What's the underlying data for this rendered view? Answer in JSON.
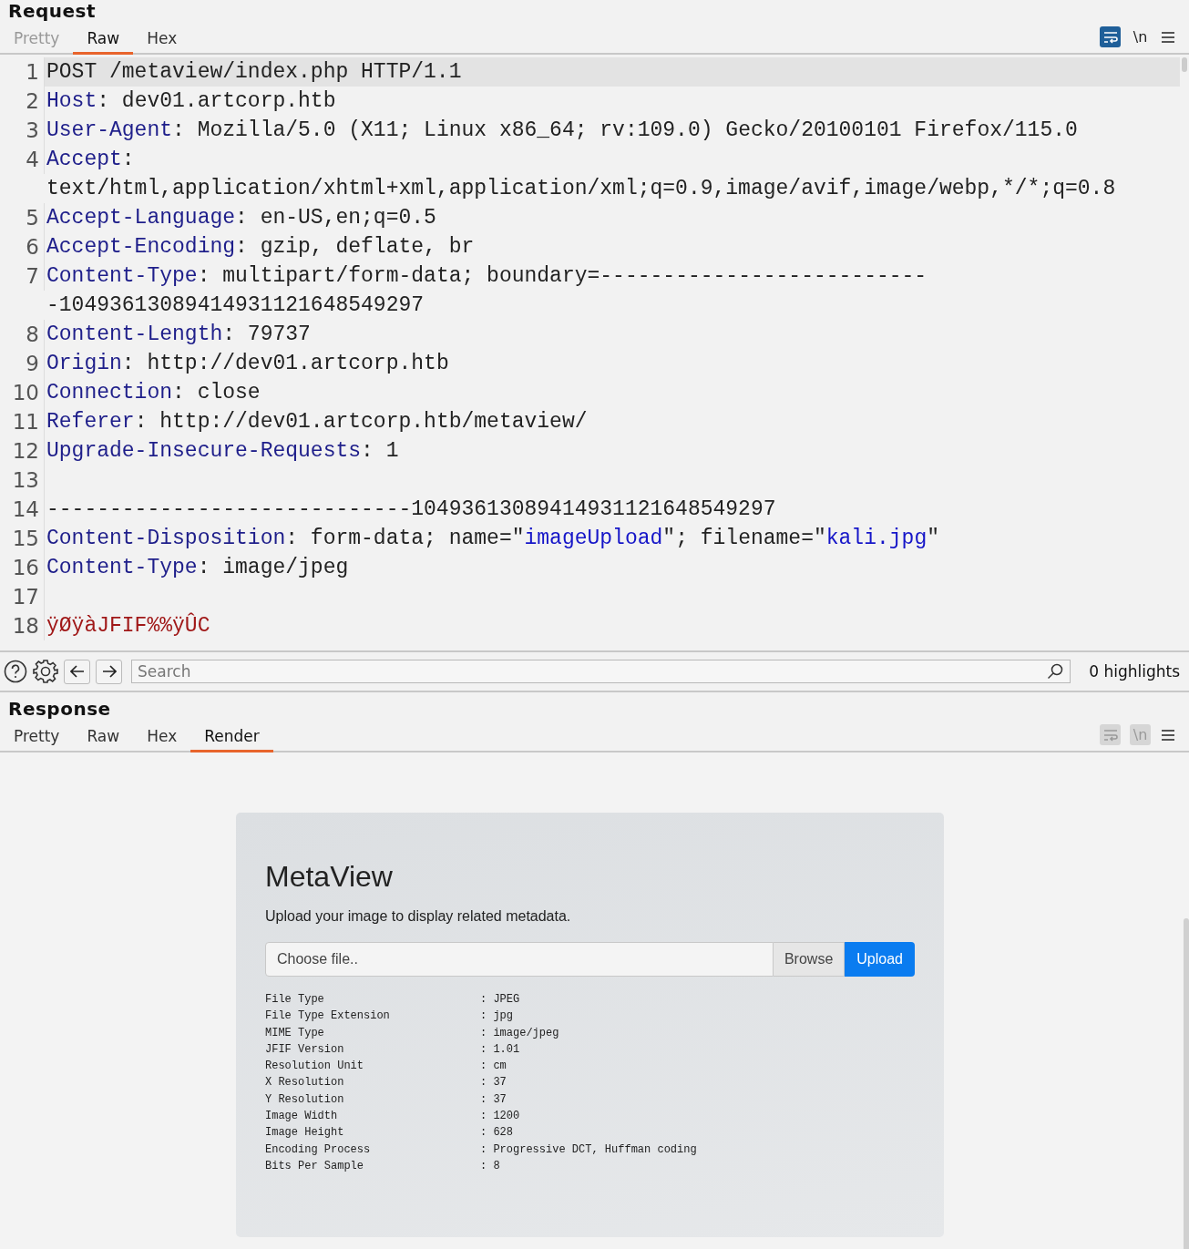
{
  "request": {
    "title": "Request",
    "tabs": [
      {
        "label": "Pretty",
        "selected": false,
        "disabled": true
      },
      {
        "label": "Raw",
        "selected": true,
        "disabled": false
      },
      {
        "label": "Hex",
        "selected": false,
        "disabled": false
      }
    ],
    "toggles": [
      {
        "kind": "wrap",
        "on": true,
        "disabled": false
      },
      {
        "kind": "newline",
        "label": "\\n",
        "on": false,
        "disabled": false
      },
      {
        "kind": "menu"
      }
    ],
    "lines": [
      {
        "number": "1",
        "highlighted": true,
        "segments": [
          {
            "kind": "text",
            "text": "POST /metaview/index.php HTTP/1.1"
          }
        ]
      },
      {
        "number": "2",
        "highlighted": false,
        "segments": [
          {
            "kind": "header",
            "text": "Host"
          },
          {
            "kind": "text",
            "text": ": dev01.artcorp.htb"
          }
        ]
      },
      {
        "number": "3",
        "highlighted": false,
        "segments": [
          {
            "kind": "header",
            "text": "User-Agent"
          },
          {
            "kind": "text",
            "text": ": Mozilla/5.0 (X11; Linux x86_64; rv:109.0) Gecko/20100101 Firefox/115.0"
          }
        ]
      },
      {
        "number": "4",
        "highlighted": false,
        "segments": [
          {
            "kind": "header",
            "text": "Accept"
          },
          {
            "kind": "text",
            "text": ": text/html,application/xhtml+xml,application/xml;q=0.9,image/avif,image/webp,*/*;q=0.8"
          }
        ]
      },
      {
        "number": "5",
        "highlighted": false,
        "segments": [
          {
            "kind": "header",
            "text": "Accept-Language"
          },
          {
            "kind": "text",
            "text": ": en-US,en;q=0.5"
          }
        ]
      },
      {
        "number": "6",
        "highlighted": false,
        "segments": [
          {
            "kind": "header",
            "text": "Accept-Encoding"
          },
          {
            "kind": "text",
            "text": ": gzip, deflate, br"
          }
        ]
      },
      {
        "number": "7",
        "highlighted": false,
        "segments": [
          {
            "kind": "header",
            "text": "Content-Type"
          },
          {
            "kind": "text",
            "text": ": multipart/form-data; boundary=---------------------------10493613089414931121648549297"
          }
        ]
      },
      {
        "number": "8",
        "highlighted": false,
        "segments": [
          {
            "kind": "header",
            "text": "Content-Length"
          },
          {
            "kind": "text",
            "text": ": 79737"
          }
        ]
      },
      {
        "number": "9",
        "highlighted": false,
        "segments": [
          {
            "kind": "header",
            "text": "Origin"
          },
          {
            "kind": "text",
            "text": ": http://dev01.artcorp.htb"
          }
        ]
      },
      {
        "number": "10",
        "highlighted": false,
        "segments": [
          {
            "kind": "header",
            "text": "Connection"
          },
          {
            "kind": "text",
            "text": ": close"
          }
        ]
      },
      {
        "number": "11",
        "highlighted": false,
        "segments": [
          {
            "kind": "header",
            "text": "Referer"
          },
          {
            "kind": "text",
            "text": ": http://dev01.artcorp.htb/metaview/"
          }
        ]
      },
      {
        "number": "12",
        "highlighted": false,
        "segments": [
          {
            "kind": "header",
            "text": "Upgrade-Insecure-Requests"
          },
          {
            "kind": "text",
            "text": ": 1"
          }
        ]
      },
      {
        "number": "13",
        "highlighted": false
      },
      {
        "number": "14",
        "highlighted": false,
        "segments": [
          {
            "kind": "text",
            "text": "-----------------------------10493613089414931121648549297"
          }
        ]
      },
      {
        "number": "15",
        "highlighted": false,
        "segments": [
          {
            "kind": "header",
            "text": "Content-Disposition"
          },
          {
            "kind": "text",
            "text": ": form-data; name=\""
          },
          {
            "kind": "string",
            "text": "imageUpload"
          },
          {
            "kind": "text",
            "text": "\"; filename=\""
          },
          {
            "kind": "string",
            "text": "kali.jpg"
          },
          {
            "kind": "text",
            "text": "\""
          }
        ]
      },
      {
        "number": "16",
        "highlighted": false,
        "segments": [
          {
            "kind": "header",
            "text": "Content-Type"
          },
          {
            "kind": "text",
            "text": ": image/jpeg"
          }
        ]
      },
      {
        "number": "17",
        "highlighted": false
      },
      {
        "number": "18",
        "highlighted": false,
        "segments": [
          {
            "kind": "binary",
            "text": "ÿØÿàJFIF%%ÿÛC"
          }
        ]
      }
    ]
  },
  "search_bar": {
    "placeholder": "Search",
    "highlights": "0 highlights"
  },
  "response": {
    "title": "Response",
    "tabs": [
      {
        "label": "Pretty",
        "selected": false,
        "disabled": false
      },
      {
        "label": "Raw",
        "selected": false,
        "disabled": false
      },
      {
        "label": "Hex",
        "selected": false,
        "disabled": false
      },
      {
        "label": "Render",
        "selected": true,
        "disabled": false
      }
    ],
    "toggles": [
      {
        "kind": "wrap",
        "disabled": true
      },
      {
        "kind": "newline",
        "label": "\\n",
        "disabled": true
      },
      {
        "kind": "menu"
      }
    ],
    "render": {
      "heading": "MetaView",
      "lead": "Upload your image to display related metadata.",
      "file_field": {
        "placeholder": "Choose file..",
        "browse": "Browse",
        "upload": "Upload"
      },
      "metadata": [
        {
          "name": "File Type",
          "value": ": JPEG"
        },
        {
          "name": "File Type Extension",
          "value": ": jpg"
        },
        {
          "name": "MIME Type",
          "value": ": image/jpeg"
        },
        {
          "name": "JFIF Version",
          "value": ": 1.01"
        },
        {
          "name": "Resolution Unit",
          "value": ": cm"
        },
        {
          "name": "X Resolution",
          "value": ": 37"
        },
        {
          "name": "Y Resolution",
          "value": ": 37"
        },
        {
          "name": "Image Width",
          "value": ": 1200"
        },
        {
          "name": "Image Height",
          "value": ": 628"
        },
        {
          "name": "Encoding Process",
          "value": ": Progressive DCT, Huffman coding"
        },
        {
          "name": "Bits Per Sample",
          "value": ": 8"
        }
      ]
    }
  }
}
